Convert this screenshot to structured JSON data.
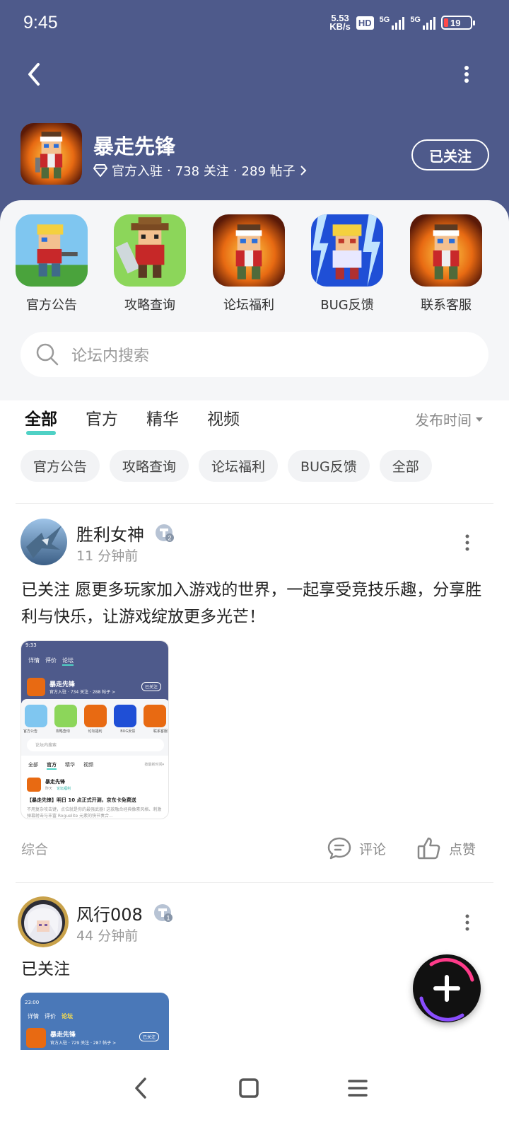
{
  "status_bar": {
    "time": "9:45",
    "net_speed_value": "5.53",
    "net_speed_unit": "KB/s",
    "hd": "HD",
    "signal1": "5G",
    "signal2": "5G",
    "battery": "19"
  },
  "forum": {
    "title": "暴走先锋",
    "meta_official": "官方入驻",
    "meta_followers": "738 关注",
    "meta_posts": "289 帖子",
    "follow_label": "已关注"
  },
  "quick_links": [
    {
      "label": "官方公告",
      "icon": "hero-blonde-gun"
    },
    {
      "label": "攻略查询",
      "icon": "hero-cowboy-sword"
    },
    {
      "label": "论坛福利",
      "icon": "hero-headband"
    },
    {
      "label": "BUG反馈",
      "icon": "hero-blonde-lightning"
    },
    {
      "label": "联系客服",
      "icon": "hero-headband"
    }
  ],
  "search": {
    "placeholder": "论坛内搜索"
  },
  "tabs": [
    "全部",
    "官方",
    "精华",
    "视频"
  ],
  "sort_label": "发布时间",
  "chips": [
    "官方公告",
    "攻略查询",
    "论坛福利",
    "BUG反馈",
    "全部"
  ],
  "posts": [
    {
      "author": "胜利女神",
      "level_badge": "2",
      "time": "11 分钟前",
      "text": "已关注 愿更多玩家加入游戏的世界，一起享受竞技乐趣，分享胜利与快乐，让游戏绽放更多光芒！",
      "category": "综合",
      "comment_label": "评论",
      "like_label": "点赞",
      "thumb": {
        "time": "9:33",
        "tabs": [
          "详情",
          "评价",
          "论坛"
        ],
        "title": "暴走先锋",
        "meta": "官方入驻 · 734 关注 · 288 帖子 >",
        "follow": "已关注",
        "icons": [
          "官方公告",
          "攻略查询",
          "论坛福利",
          "BUG反馈",
          "联系客服"
        ],
        "search": "论坛内搜索",
        "feed_tabs": [
          "全部",
          "官方",
          "精华",
          "视频"
        ],
        "sort": "按最新时间▾",
        "post_author": "暴走先锋",
        "post_time": "昨天",
        "post_tag": "论坛福利",
        "post_title": "【暴走先锋】明日 10 点正式开测，京东卡免费送",
        "post_body": "不用复杂攻击键，点位就是你的最强武器! 这款融合经典像素风格、刺激弹幕射击与丰富 Roguelite 元素的快节奏合..."
      }
    },
    {
      "author": "风行008",
      "level_badge": "1",
      "time": "44 分钟前",
      "text": "已关注",
      "thumb": {
        "time": "23:00",
        "tabs": [
          "详情",
          "评价",
          "论坛"
        ],
        "title": "暴走先锋",
        "meta": "官方入驻 · 729 关注 · 287 帖子 >",
        "follow": "已关注"
      }
    }
  ],
  "colors": {
    "header": "#4e5a8b",
    "accent": "#4fd1c5",
    "panel": "#f5f6f8"
  }
}
